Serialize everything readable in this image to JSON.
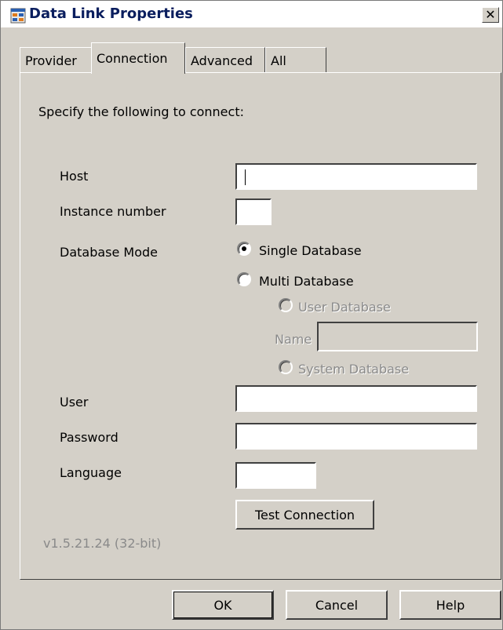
{
  "window": {
    "title": "Data Link Properties",
    "close_glyph": "✕"
  },
  "tabs": [
    {
      "label": "Provider"
    },
    {
      "label": "Connection"
    },
    {
      "label": "Advanced"
    },
    {
      "label": "All"
    }
  ],
  "active_tab": "Connection",
  "connection": {
    "instruction": "Specify the following to connect:",
    "host_label": "Host",
    "host_value": "",
    "instance_label": "Instance number",
    "instance_value": "",
    "db_mode_label": "Database Mode",
    "single_db_label": "Single Database",
    "multi_db_label": "Multi Database",
    "user_db_label": "User Database",
    "name_label": "Name",
    "name_value": "",
    "system_db_label": "System Database",
    "selected_mode": "Single Database",
    "user_label": "User",
    "user_value": "",
    "password_label": "Password",
    "password_value": "",
    "language_label": "Language",
    "language_value": "",
    "test_button": "Test Connection",
    "version": "v1.5.21.24 (32-bit)"
  },
  "footer": {
    "ok": "OK",
    "cancel": "Cancel",
    "help": "Help"
  },
  "colors": {
    "dialog_bg": "#d4d0c8",
    "title_text": "#0a1e5e",
    "disabled_text": "#8a8a8a"
  },
  "icons": {
    "title": "data-link-icon",
    "close": "close-icon"
  }
}
